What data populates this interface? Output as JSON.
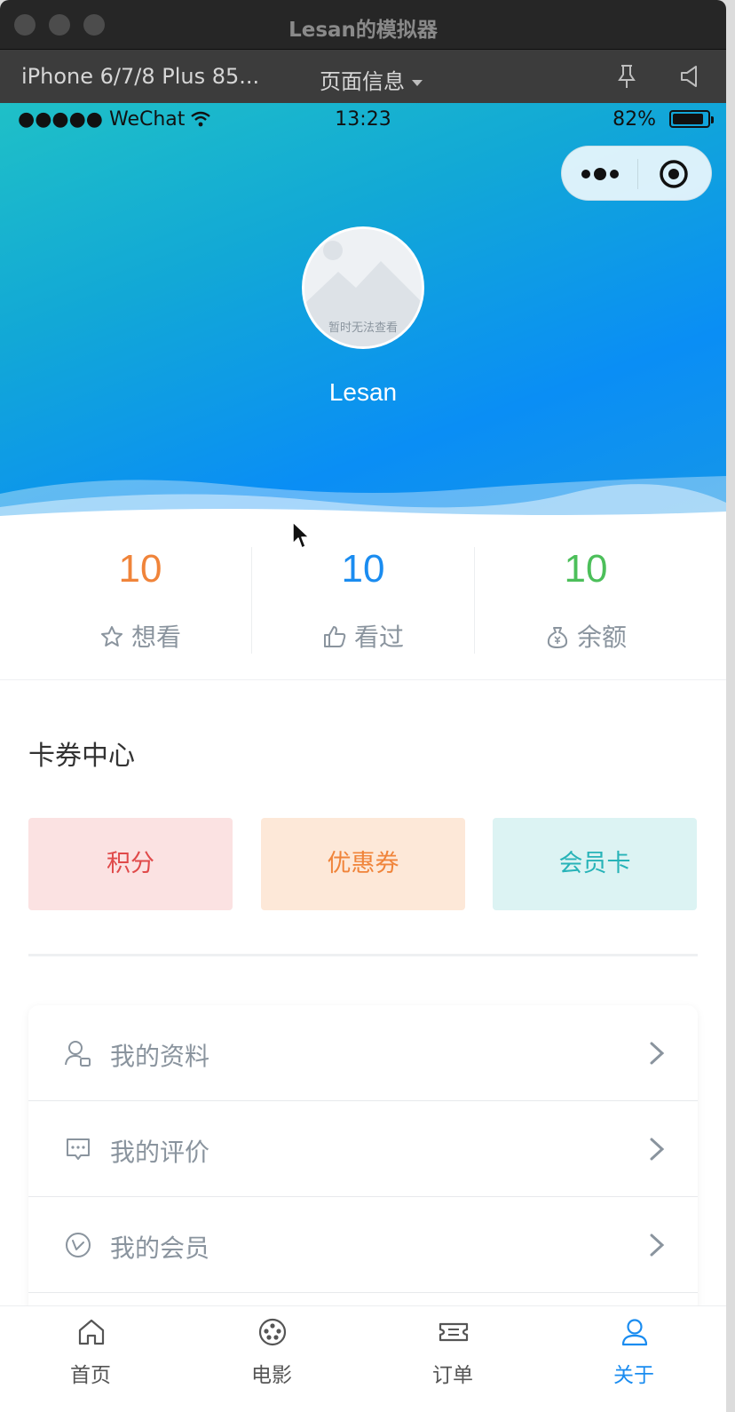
{
  "window": {
    "title": "Lesan的模拟器"
  },
  "devtools": {
    "device": "iPhone 6/7/8 Plus 85...",
    "page_info": "页面信息"
  },
  "statusbar": {
    "carrier": "●●●●● WeChat",
    "time": "13:23",
    "battery": "82%"
  },
  "profile": {
    "avatar_placeholder": "暂时无法查看",
    "username": "Lesan"
  },
  "stats": [
    {
      "value": "10",
      "label": "想看",
      "icon": "star-icon",
      "color": "#f0843a"
    },
    {
      "value": "10",
      "label": "看过",
      "icon": "thumbs-up-icon",
      "color": "#1a8cf0"
    },
    {
      "value": "10",
      "label": "余额",
      "icon": "money-bag-icon",
      "color": "#4cbf5a"
    }
  ],
  "card_center": {
    "title": "卡券中心",
    "items": [
      {
        "label": "积分",
        "bg": "#fbe2e2",
        "color": "#e04a4a"
      },
      {
        "label": "优惠券",
        "bg": "#fde8d8",
        "color": "#f0843a"
      },
      {
        "label": "会员卡",
        "bg": "#dcf3f3",
        "color": "#27b3b8"
      }
    ]
  },
  "menu": [
    {
      "label": "我的资料",
      "icon": "profile-icon"
    },
    {
      "label": "我的评价",
      "icon": "comment-icon"
    },
    {
      "label": "我的会员",
      "icon": "member-icon"
    }
  ],
  "tabbar": [
    {
      "label": "首页",
      "icon": "home-icon",
      "active": false
    },
    {
      "label": "电影",
      "icon": "film-reel-icon",
      "active": false
    },
    {
      "label": "订单",
      "icon": "ticket-icon",
      "active": false
    },
    {
      "label": "关于",
      "icon": "user-icon",
      "active": true
    }
  ],
  "colors": {
    "accent": "#1a8cf0",
    "hero_start": "#1fc0c7",
    "hero_end": "#0a8ef5"
  }
}
